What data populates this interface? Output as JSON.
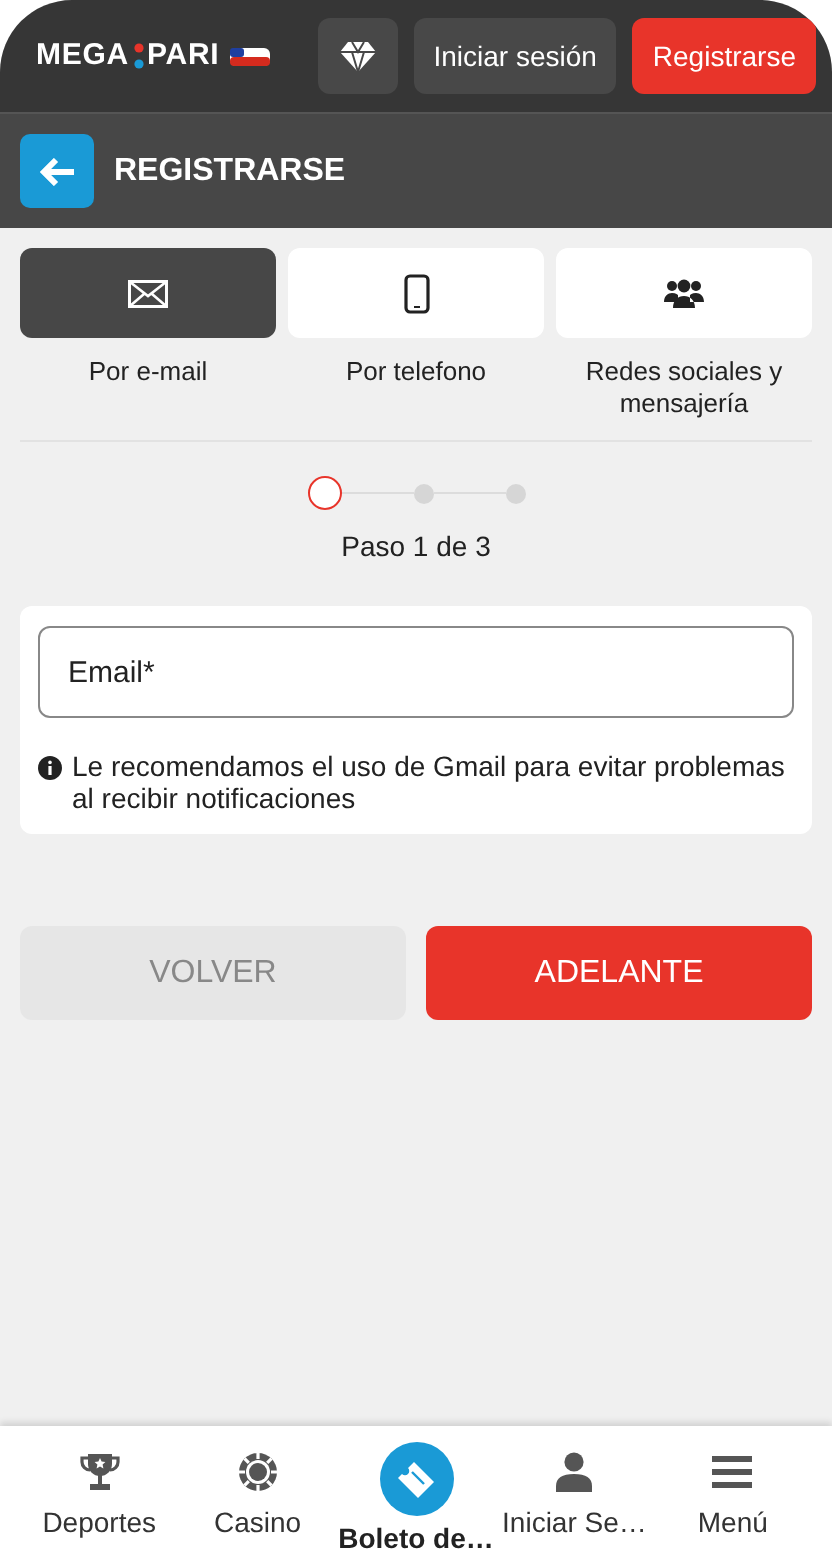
{
  "header": {
    "logo": {
      "left": "MEGA",
      "right": "PARI"
    },
    "login_button": "Iniciar sesión",
    "register_button": "Registrarse"
  },
  "title_bar": {
    "title": "REGISTRARSE"
  },
  "methods": [
    {
      "kind": "email",
      "label": "Por e-mail",
      "selected": true
    },
    {
      "kind": "phone",
      "label": "Por telefono",
      "selected": false
    },
    {
      "kind": "social",
      "label": "Redes sociales y mensajería",
      "selected": false
    }
  ],
  "stepper": {
    "steps": [
      {
        "selected": true
      },
      {
        "selected": false
      },
      {
        "selected": false
      }
    ],
    "caption": "Paso 1 de 3"
  },
  "form": {
    "email": {
      "placeholder": "Email*"
    },
    "hint": "Le recomendamos el uso de Gmail para evitar problemas al recibir notificaciones"
  },
  "actions": {
    "back": {
      "label": "VOLVER",
      "disabled": true
    },
    "next": {
      "label": "ADELANTE",
      "disabled": false
    }
  },
  "bottom_nav": [
    {
      "kind": "trophy",
      "label": "Deportes",
      "selected": false
    },
    {
      "kind": "chip",
      "label": "Casino",
      "selected": false
    },
    {
      "kind": "ticket",
      "label": "Boleto de…",
      "selected": true
    },
    {
      "kind": "user",
      "label": "Iniciar Se…",
      "selected": false
    },
    {
      "kind": "menu",
      "label": "Menú",
      "selected": false
    }
  ]
}
